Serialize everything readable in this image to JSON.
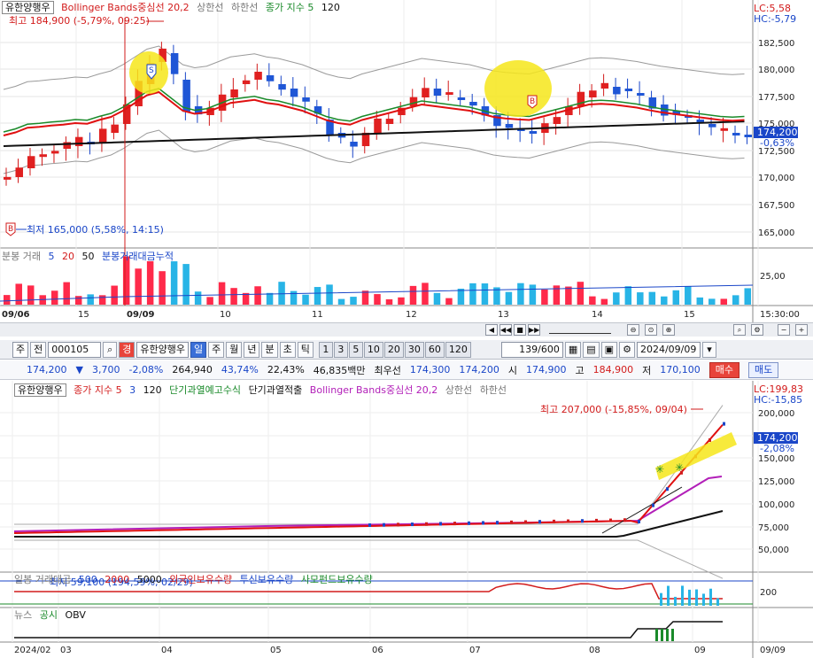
{
  "top": {
    "legend": {
      "stock": "유한양행우",
      "bb": "Bollinger Bands중심선 20,2",
      "upper": "상한선",
      "lower": "하한선",
      "close_ma": "종가 지수 5",
      "ma120": "120"
    },
    "high_label": "최고 184,900 (-5,79%, 09:25)",
    "low_label": "최저 165,000 (5,58%, 14:15)",
    "lc": "LC:5,58",
    "hc": "HC:-5,79",
    "price_now": "174,200",
    "price_change": "-0,63%",
    "yaxis": [
      "182,500",
      "180,000",
      "177,500",
      "175,000",
      "172,500",
      "170,000",
      "167,500",
      "165,000"
    ],
    "vol_legend": {
      "title": "분봉 거래",
      "m5": "5",
      "m20": "20",
      "m50": "50",
      "cum": "분봉거래대금누적"
    },
    "vol_axis": "25,00",
    "xaxis": [
      "09/06",
      "15",
      "09/09",
      "10",
      "11",
      "12",
      "13",
      "14",
      "15",
      "15:30:00"
    ],
    "marker_s": "S",
    "marker_b": "B"
  },
  "toolbar": {
    "mode": "주",
    "all": "전",
    "code": "000105",
    "gyeong": "경",
    "name": "유한양행우",
    "periods": [
      "일",
      "주",
      "월",
      "년",
      "분",
      "초",
      "틱"
    ],
    "active_period": "일",
    "ticks": [
      "1",
      "3",
      "5",
      "10",
      "20",
      "30",
      "60",
      "120"
    ],
    "count": "139/600",
    "date": "2024/09/09",
    "buy": "매수",
    "sell": "매도"
  },
  "quote": {
    "price": "174,200",
    "arrow": "▼",
    "change": "3,700",
    "pct": "-2,08%",
    "volume": "264,940",
    "ratio1": "43,74%",
    "ratio2": "22,43%",
    "value": "46,835백만",
    "prio_label": "최우선",
    "prio1": "174,300",
    "prio2": "174,200",
    "open_label": "시",
    "open": "174,900",
    "high_label": "고",
    "high": "184,900",
    "low_label": "저",
    "low": "170,100"
  },
  "bottom": {
    "legend": {
      "stock": "유한양행우",
      "close_ma": "종가 지수 5",
      "m3": "3",
      "m120": "120",
      "overheat": "단기과열예고수식",
      "overheat2": "단기과열적출",
      "bb": "Bollinger Bands중심선 20,2",
      "upper": "상한선",
      "lower": "하한선"
    },
    "high_label": "최고 207,000 (-15,85%, 09/04)",
    "low_label": "최저 59,100 (194,59%, 02/29)",
    "lc": "LC:199,83",
    "hc": "HC:-15,85",
    "price_now": "174,200",
    "price_change": "-2,08%",
    "yaxis": [
      "200,000",
      "175,000",
      "150,000",
      "125,000",
      "100,000",
      "75,000",
      "50,000"
    ],
    "vol_legend": {
      "title": "일봉 거래대금",
      "m500": "500",
      "m2000": "2000",
      "m5000": "5000",
      "foreign": "외국인보유수량",
      "trust": "투신보유수량",
      "pension": "사모펀드보유수량"
    },
    "vol_axis": "200",
    "obv_legend": {
      "news": "뉴스",
      "notice": "공시",
      "obv": "OBV"
    },
    "xaxis": [
      "2024/02",
      "03",
      "04",
      "05",
      "06",
      "07",
      "08",
      "09",
      "09/09"
    ]
  }
}
